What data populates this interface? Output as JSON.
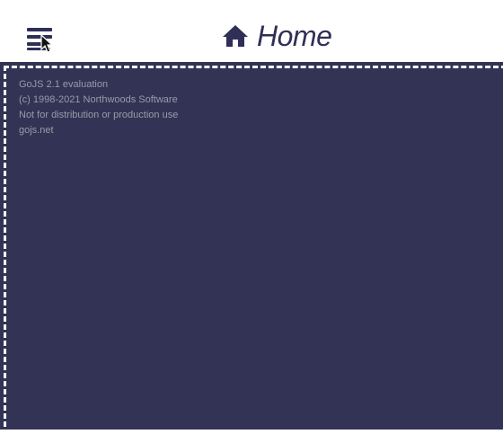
{
  "header": {
    "title": "Home",
    "menu_icon": "menu-hamburger-icon",
    "home_icon": "home-icon"
  },
  "colors": {
    "header_text": "#2f2f57",
    "canvas_background": "#333355",
    "canvas_border": "#ffffff",
    "watermark_text": "#9a9aa8"
  },
  "canvas": {
    "watermark": {
      "line1": "GoJS 2.1 evaluation",
      "line2": "(c) 1998-2021 Northwoods Software",
      "line3": "Not for distribution or production use",
      "line4": "gojs.net"
    }
  }
}
